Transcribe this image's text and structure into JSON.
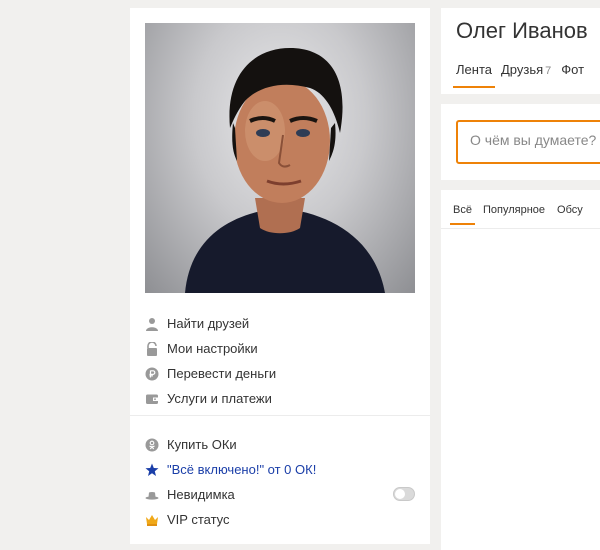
{
  "profile": {
    "name": "Олег Иванов",
    "tabs": [
      {
        "label": "Лента",
        "active": true
      },
      {
        "label": "Друзья",
        "count": "7"
      },
      {
        "label": "Фот"
      }
    ]
  },
  "post": {
    "placeholder": "О чём вы думаете?"
  },
  "feed": {
    "tabs": [
      {
        "label": "Всё",
        "active": true
      },
      {
        "label": "Популярное"
      },
      {
        "label": "Обсу"
      }
    ]
  },
  "menu": {
    "primary": [
      {
        "label": "Найти друзей",
        "icon": "person-icon"
      },
      {
        "label": "Мои настройки",
        "icon": "lock-icon"
      },
      {
        "label": "Перевести деньги",
        "icon": "ruble-coin-icon"
      },
      {
        "label": "Услуги и платежи",
        "icon": "wallet-icon"
      }
    ],
    "secondary": [
      {
        "label": "Купить ОКи",
        "icon": "ok-coin-icon"
      },
      {
        "label": "\"Всё включено!\" от 0 ОК!",
        "icon": "star-icon"
      },
      {
        "label": "Невидимка",
        "icon": "hat-icon",
        "toggle": false
      },
      {
        "label": "VIP статус",
        "icon": "crown-icon"
      }
    ]
  },
  "colors": {
    "accent": "#ee8208",
    "link": "#1a3ea8",
    "background": "#f1f0ee"
  }
}
